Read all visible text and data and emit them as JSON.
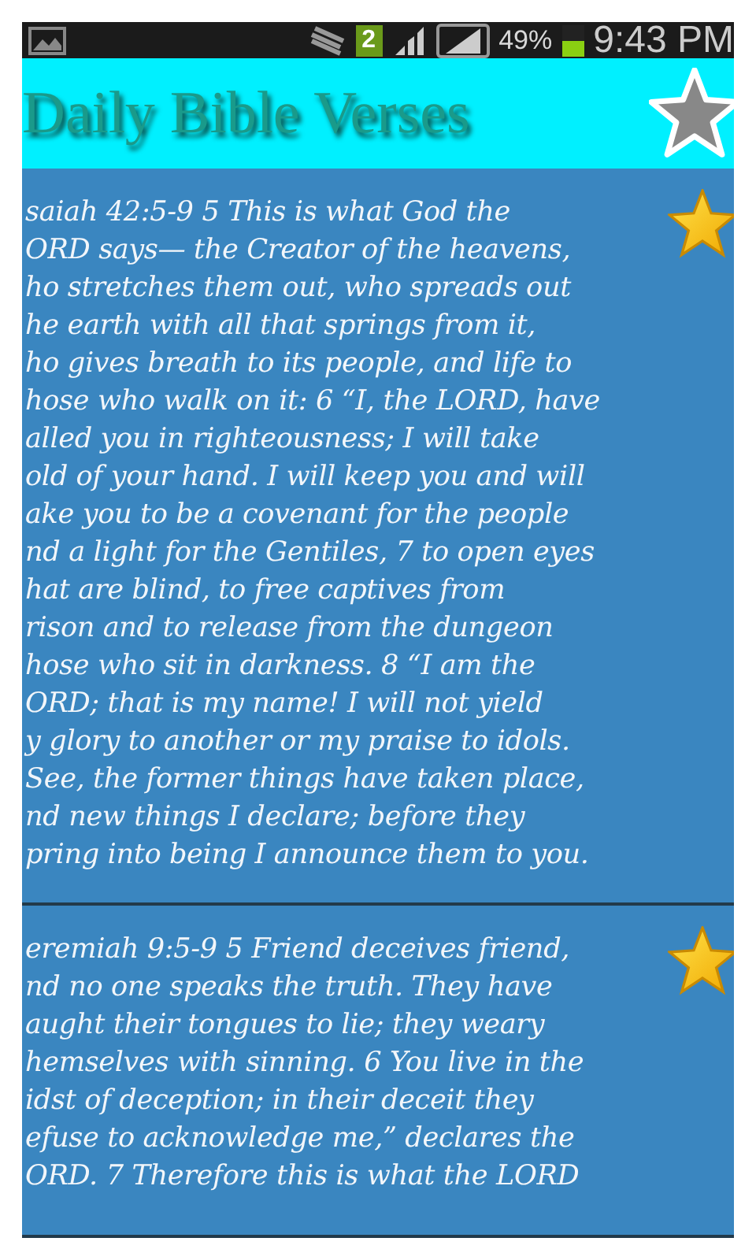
{
  "status_bar": {
    "notification_count": "2",
    "battery": "49%",
    "time": "9:43 PM"
  },
  "header": {
    "title": "Daily Bible Verses"
  },
  "verses": [
    {
      "favorite": true,
      "lines": [
        "saiah 42:5-9 5 This is what God the",
        "ORD says— the Creator of the heavens,",
        "ho stretches them out, who spreads out",
        "he earth with all that springs from it,",
        "ho gives breath to its people, and life to",
        "hose who walk on it: 6 “I, the LORD, have",
        "alled you in righteousness; I will take",
        "old of your hand. I will keep you and will",
        "ake you to be a covenant for the people",
        "nd a light for the Gentiles, 7 to open eyes",
        "hat are blind, to free captives from",
        "rison and to release from the dungeon",
        "hose who sit in darkness. 8 “I am the",
        "ORD; that is my name! I will not yield",
        "y glory to another or my praise to idols.",
        "See, the former things have taken place,",
        "nd new things I declare; before they",
        "pring into being I announce them to you."
      ]
    },
    {
      "favorite": true,
      "lines": [
        "eremiah 9:5-9 5 Friend deceives friend,",
        "nd no one speaks the truth. They have",
        "aught their tongues to lie; they weary",
        "hemselves with sinning. 6 You live in the",
        "idst of deception; in their deceit they",
        "efuse to acknowledge me,” declares the",
        "ORD. 7 Therefore this is what the LORD"
      ]
    }
  ]
}
